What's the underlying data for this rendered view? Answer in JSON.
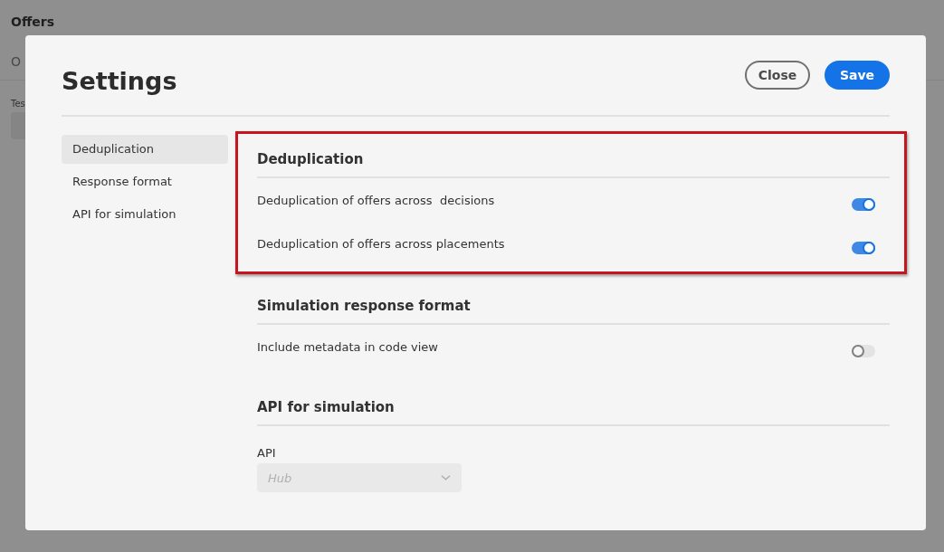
{
  "background_page": {
    "title": "Offers",
    "tab": "O",
    "field_label": "Tes"
  },
  "dialog": {
    "title": "Settings",
    "buttons": [
      {
        "label": "Close",
        "kind": "secondary"
      },
      {
        "label": "Save",
        "kind": "primary"
      }
    ],
    "nav": [
      {
        "label": "Deduplication",
        "selected": true
      },
      {
        "label": "Response format",
        "selected": false
      },
      {
        "label": "API for simulation",
        "selected": false
      }
    ],
    "sections": [
      {
        "heading": "Deduplication",
        "highlighted": true,
        "items": [
          {
            "kind": "toggle",
            "label": "Deduplication of offers across  decisions",
            "on": true
          },
          {
            "kind": "toggle",
            "label": "Deduplication of offers across placements",
            "on": true
          }
        ]
      },
      {
        "heading": "Simulation response format",
        "highlighted": false,
        "items": [
          {
            "kind": "toggle",
            "label": "Include metadata in code view",
            "on": false
          }
        ]
      },
      {
        "heading": "API for simulation",
        "highlighted": false,
        "items": [
          {
            "kind": "dropdown",
            "label": "API",
            "value": "Hub",
            "disabled": true
          }
        ]
      }
    ]
  }
}
